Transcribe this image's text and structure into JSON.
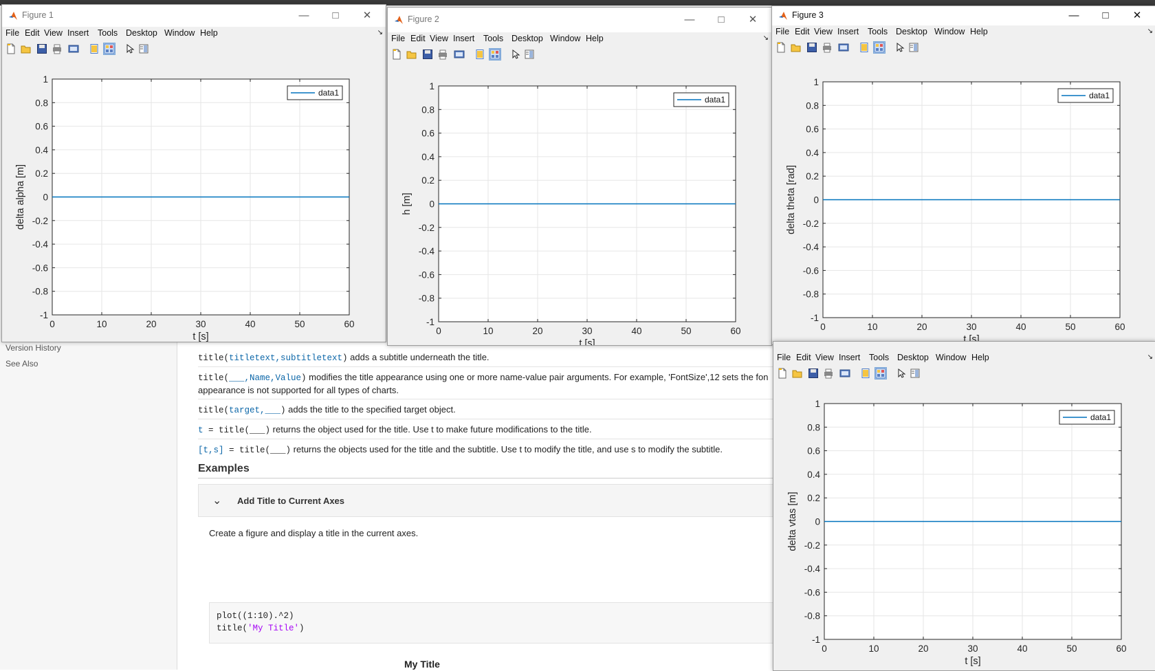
{
  "doc": {
    "sidebar": {
      "version_history": "Version History",
      "see_also": "See Also"
    },
    "syntax_lines": [
      {
        "code": "title(",
        "args": "titletext,subtitletext",
        "code_end": ")",
        "desc": " adds a subtitle underneath the title."
      },
      {
        "code": "title(",
        "args": "___,Name,Value",
        "code_end": ")",
        "desc": " modifies the title appearance using one or more name-value pair arguments. For example, 'FontSize',12 sets the fon"
      },
      {
        "desc2": "appearance is not supported for all types of charts."
      },
      {
        "code": "title(",
        "args": "target,___",
        "code_end": ")",
        "desc": " adds the title to the specified target object."
      },
      {
        "code": "t",
        "args": "",
        "code_end": " = title(___)",
        "desc": " returns the object used for the title. Use t to make future modifications to the title."
      },
      {
        "code": "[t,s]",
        "args": "",
        "code_end": " = title(___)",
        "desc": " returns the objects used for the title and the subtitle. Use t to modify the title, and use s to modify the subtitle."
      }
    ],
    "examples_heading": "Examples",
    "accordion_label": "Add Title to Current Axes",
    "example_text": "Create a figure and display a title in the current axes.",
    "code_lines": [
      "plot((1:10).^2)",
      "title('My Title')"
    ],
    "plot_title_preview": "My Title"
  },
  "menu_items": [
    "File",
    "Edit",
    "View",
    "Insert",
    "Tools",
    "Desktop",
    "Window",
    "Help"
  ],
  "toolbar_icons": [
    "new-figure-icon",
    "open-file-icon",
    "save-icon",
    "print-icon",
    "link-plot-icon",
    "hide-plot-tools-icon",
    "show-plot-tools-icon",
    "edit-plot-icon",
    "open-property-inspector-icon"
  ],
  "colors": {
    "line": "#0072bd",
    "axes_bg": "#ffffff",
    "grid": "#e6e6e6",
    "figure_bg": "#f0f0f0"
  },
  "figures": [
    {
      "id": "fig1",
      "title": "Figure 1",
      "active": false,
      "ylabel": "delta alpha [m]",
      "xlabel": "t [s]"
    },
    {
      "id": "fig2",
      "title": "Figure 2",
      "active": false,
      "ylabel": "h [m]",
      "xlabel": "t [s]"
    },
    {
      "id": "fig3",
      "title": "Figure 3",
      "active": true,
      "ylabel": "delta theta [rad]",
      "xlabel": "t [s]"
    },
    {
      "id": "fig4",
      "title": "",
      "active": false,
      "ylabel": "delta vtas [m]",
      "xlabel": "t [s]"
    }
  ],
  "chart_data": [
    {
      "type": "line",
      "series": [
        {
          "name": "data1",
          "x": [
            0,
            60
          ],
          "y": [
            0,
            0
          ]
        }
      ],
      "xlabel": "t [s]",
      "ylabel": "delta alpha [m]",
      "xlim": [
        0,
        60
      ],
      "ylim": [
        -1,
        1
      ],
      "xticks": [
        "0",
        "10",
        "20",
        "30",
        "40",
        "50",
        "60"
      ],
      "yticks": [
        "-1",
        "-0.8",
        "-0.6",
        "-0.4",
        "-0.2",
        "0",
        "0.2",
        "0.4",
        "0.6",
        "0.8",
        "1"
      ],
      "grid": true,
      "legend": "top-right"
    },
    {
      "type": "line",
      "series": [
        {
          "name": "data1",
          "x": [
            0,
            60
          ],
          "y": [
            0,
            0
          ]
        }
      ],
      "xlabel": "t [s]",
      "ylabel": "h [m]",
      "xlim": [
        0,
        60
      ],
      "ylim": [
        -1,
        1
      ],
      "xticks": [
        "0",
        "10",
        "20",
        "30",
        "40",
        "50",
        "60"
      ],
      "yticks": [
        "-1",
        "-0.8",
        "-0.6",
        "-0.4",
        "-0.2",
        "0",
        "0.2",
        "0.4",
        "0.6",
        "0.8",
        "1"
      ],
      "grid": true,
      "legend": "top-right"
    },
    {
      "type": "line",
      "series": [
        {
          "name": "data1",
          "x": [
            0,
            60
          ],
          "y": [
            0,
            0
          ]
        }
      ],
      "xlabel": "t [s]",
      "ylabel": "delta theta [rad]",
      "xlim": [
        0,
        60
      ],
      "ylim": [
        -1,
        1
      ],
      "xticks": [
        "0",
        "10",
        "20",
        "30",
        "40",
        "50",
        "60"
      ],
      "yticks": [
        "-1",
        "-0.8",
        "-0.6",
        "-0.4",
        "-0.2",
        "0",
        "0.2",
        "0.4",
        "0.6",
        "0.8",
        "1"
      ],
      "grid": true,
      "legend": "top-right"
    },
    {
      "type": "line",
      "series": [
        {
          "name": "data1",
          "x": [
            0,
            60
          ],
          "y": [
            0,
            0
          ]
        }
      ],
      "xlabel": "t [s]",
      "ylabel": "delta vtas [m]",
      "xlim": [
        0,
        60
      ],
      "ylim": [
        -1,
        1
      ],
      "xticks": [
        "0",
        "10",
        "20",
        "30",
        "40",
        "50",
        "60"
      ],
      "yticks": [
        "-1",
        "-0.8",
        "-0.6",
        "-0.4",
        "-0.2",
        "0",
        "0.2",
        "0.4",
        "0.6",
        "0.8",
        "1"
      ],
      "grid": true,
      "legend": "top-right"
    }
  ]
}
